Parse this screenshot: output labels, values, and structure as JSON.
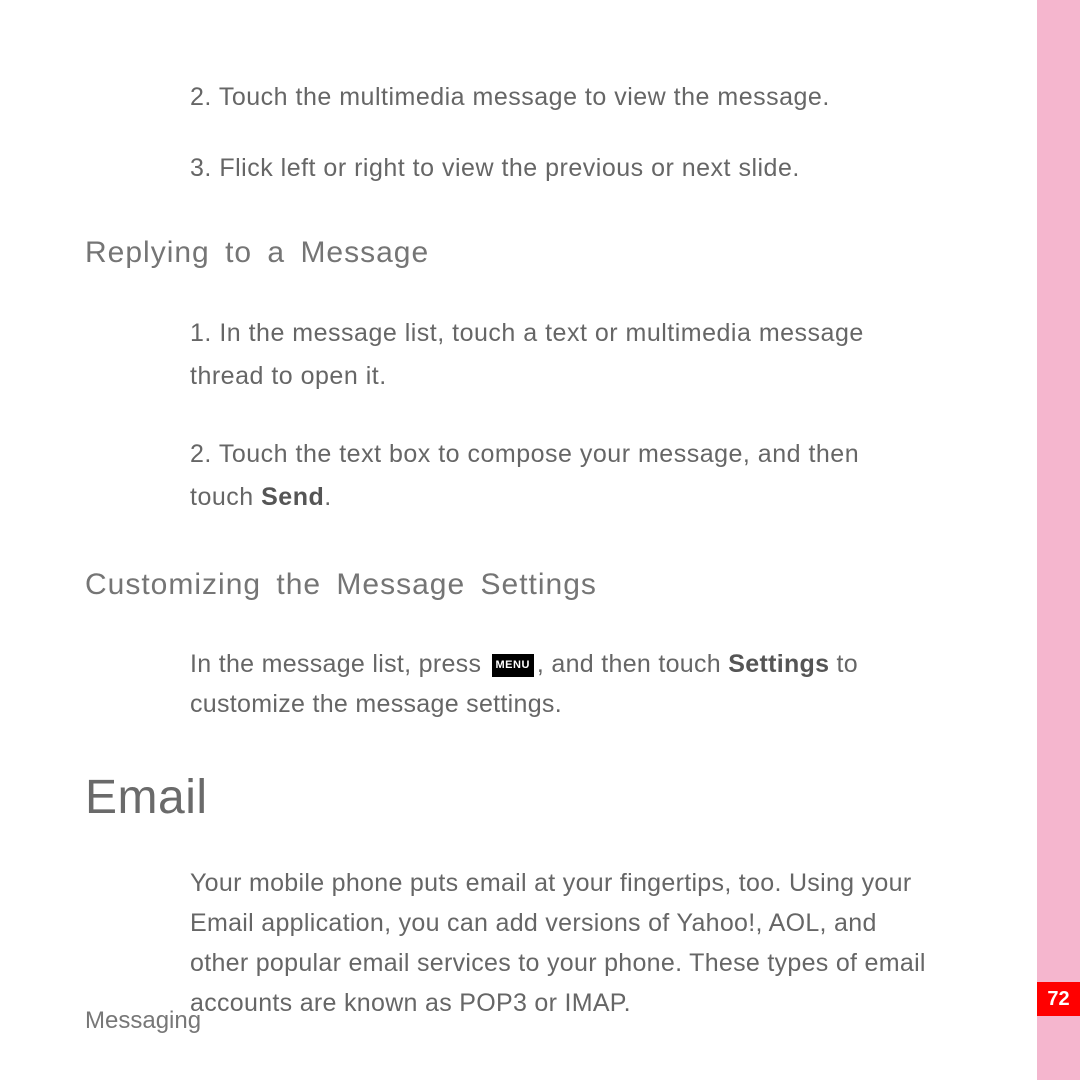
{
  "intro_items": [
    {
      "num": "2.",
      "text": "Touch the multimedia message to view the message."
    },
    {
      "num": "3.",
      "text": "Flick left or right to view the previous or next slide."
    }
  ],
  "section1": {
    "heading": "Replying to a Message",
    "items": [
      {
        "num": "1.",
        "text": "In the message list, touch a text or multimedia message thread to open it."
      },
      {
        "num": "2.",
        "text_before": "Touch the text box to compose your message, and then touch ",
        "strong": "Send",
        "text_after": "."
      }
    ]
  },
  "section2": {
    "heading": "Customizing the Message Settings",
    "body_before": "In the message list, press ",
    "menu_label": "MENU",
    "body_mid": ", and then touch ",
    "strong": "Settings",
    "body_after": " to customize the message settings."
  },
  "section3": {
    "heading": "Email",
    "body": "Your mobile phone puts email at your fingertips, too. Using your Email application, you can add versions of Yahoo!, AOL, and other popular email services to your phone. These types of email accounts are known as POP3 or IMAP."
  },
  "footer": "Messaging",
  "page_number": "72"
}
